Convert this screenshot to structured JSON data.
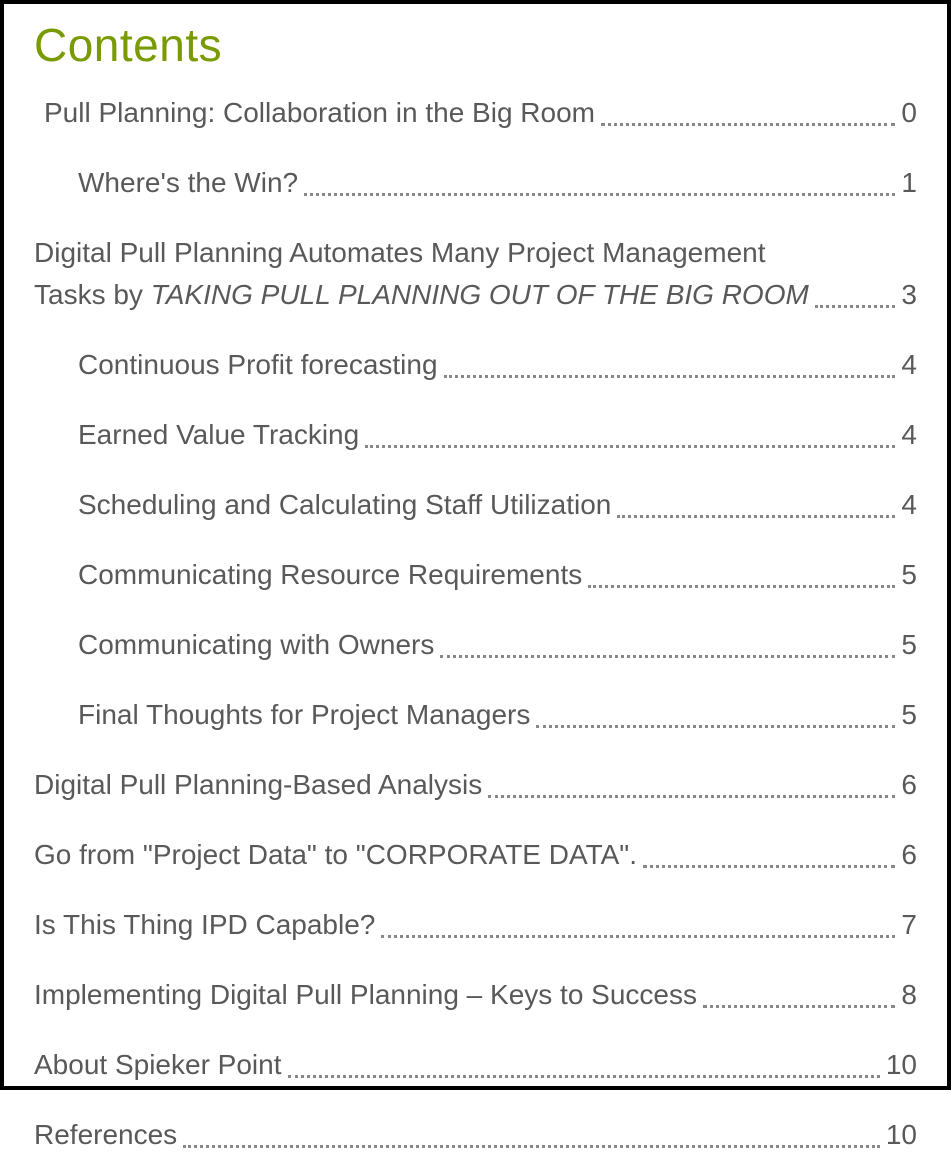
{
  "heading": "Contents",
  "entries": [
    {
      "level": 1,
      "label": "Pull Planning: Collaboration in the Big Room",
      "page": "0",
      "firstIndent": true
    },
    {
      "level": 2,
      "label": "Where's the Win?",
      "page": "1"
    },
    {
      "level": 1,
      "multiline": true,
      "line1": "Digital Pull Planning Automates Many Project Management",
      "line2a": "Tasks by ",
      "line2b_italic": "TAKING PULL PLANNING OUT OF THE BIG ROOM",
      "page": "3"
    },
    {
      "level": 2,
      "label": "Continuous Profit forecasting",
      "page": "4"
    },
    {
      "level": 2,
      "label": "Earned Value Tracking",
      "page": "4"
    },
    {
      "level": 2,
      "label": "Scheduling and Calculating Staff Utilization",
      "page": "4"
    },
    {
      "level": 2,
      "label": "Communicating Resource Requirements",
      "page": "5"
    },
    {
      "level": 2,
      "label": "Communicating with Owners",
      "page": "5"
    },
    {
      "level": 2,
      "label": "Final Thoughts for Project Managers",
      "page": "5"
    },
    {
      "level": 1,
      "label": "Digital Pull Planning-Based Analysis",
      "page": "6"
    },
    {
      "level": 1,
      "label": "Go from \"Project Data\" to \"CORPORATE DATA\".",
      "page": "6"
    },
    {
      "level": 1,
      "label": "Is This Thing IPD Capable?",
      "page": "7"
    },
    {
      "level": 1,
      "label": "Implementing Digital Pull Planning – Keys to Success",
      "page": "8"
    },
    {
      "level": 1,
      "label": "About Spieker Point",
      "page": "10"
    },
    {
      "level": 1,
      "label": "References",
      "page": "10"
    }
  ]
}
